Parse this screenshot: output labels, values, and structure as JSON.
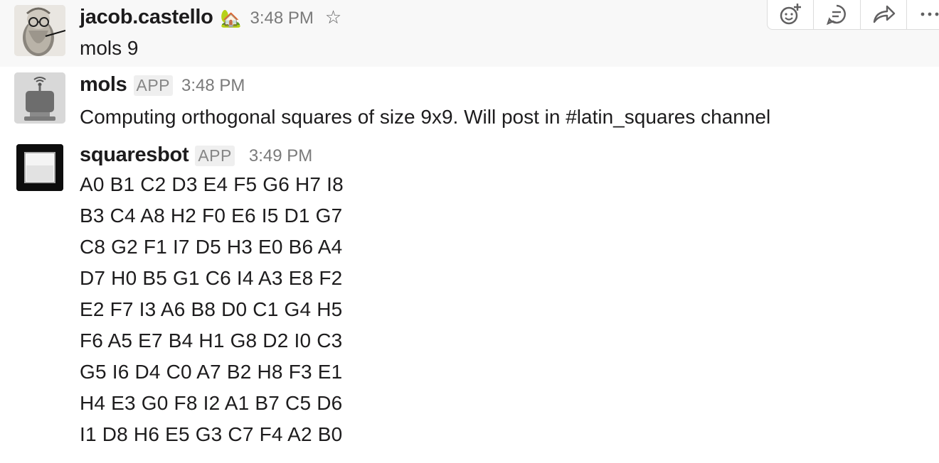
{
  "messages": [
    {
      "user": "jacob.castello",
      "status_emoji": "🏡",
      "time": "3:48 PM",
      "text": "mols 9",
      "avatar_icon": "bearded-man-avatar-icon"
    },
    {
      "user": "mols",
      "badge": "APP",
      "time": "3:48 PM",
      "text": "Computing orthogonal squares of size 9x9. Will post in #latin_squares channel",
      "avatar_icon": "robot-avatar-icon"
    },
    {
      "user": "squaresbot",
      "badge": "APP",
      "time": "3:49 PM",
      "avatar_icon": "black-square-avatar-icon",
      "lines": [
        "A0 B1 C2 D3 E4 F5 G6 H7 I8",
        "B3 C4 A8 H2 F0 E6 I5 D1 G7",
        "C8 G2 F1 I7 D5 H3 E0 B6 A4",
        "D7 H0 B5 G1 C6 I4 A3 E8 F2",
        "E2 F7 I3 A6 B8 D0 C1 G4 H5",
        "F6 A5 E7 B4 H1 G8 D2 I0 C3",
        "G5 I6 D4 C0 A7 B2 H8 F3 E1",
        "H4 E3 G0 F8 I2 A1 B7 C5 D6",
        "I1 D8 H6 E5 G3 C7 F4 A2 B0"
      ]
    }
  ],
  "hover_actions": [
    "add-reaction-icon",
    "reply-in-thread-icon",
    "share-message-icon",
    "more-actions-icon"
  ],
  "colors": {
    "hover_background": "#f8f8f8",
    "badge_background": "#efefef",
    "muted_text": "#7a7a7a"
  }
}
